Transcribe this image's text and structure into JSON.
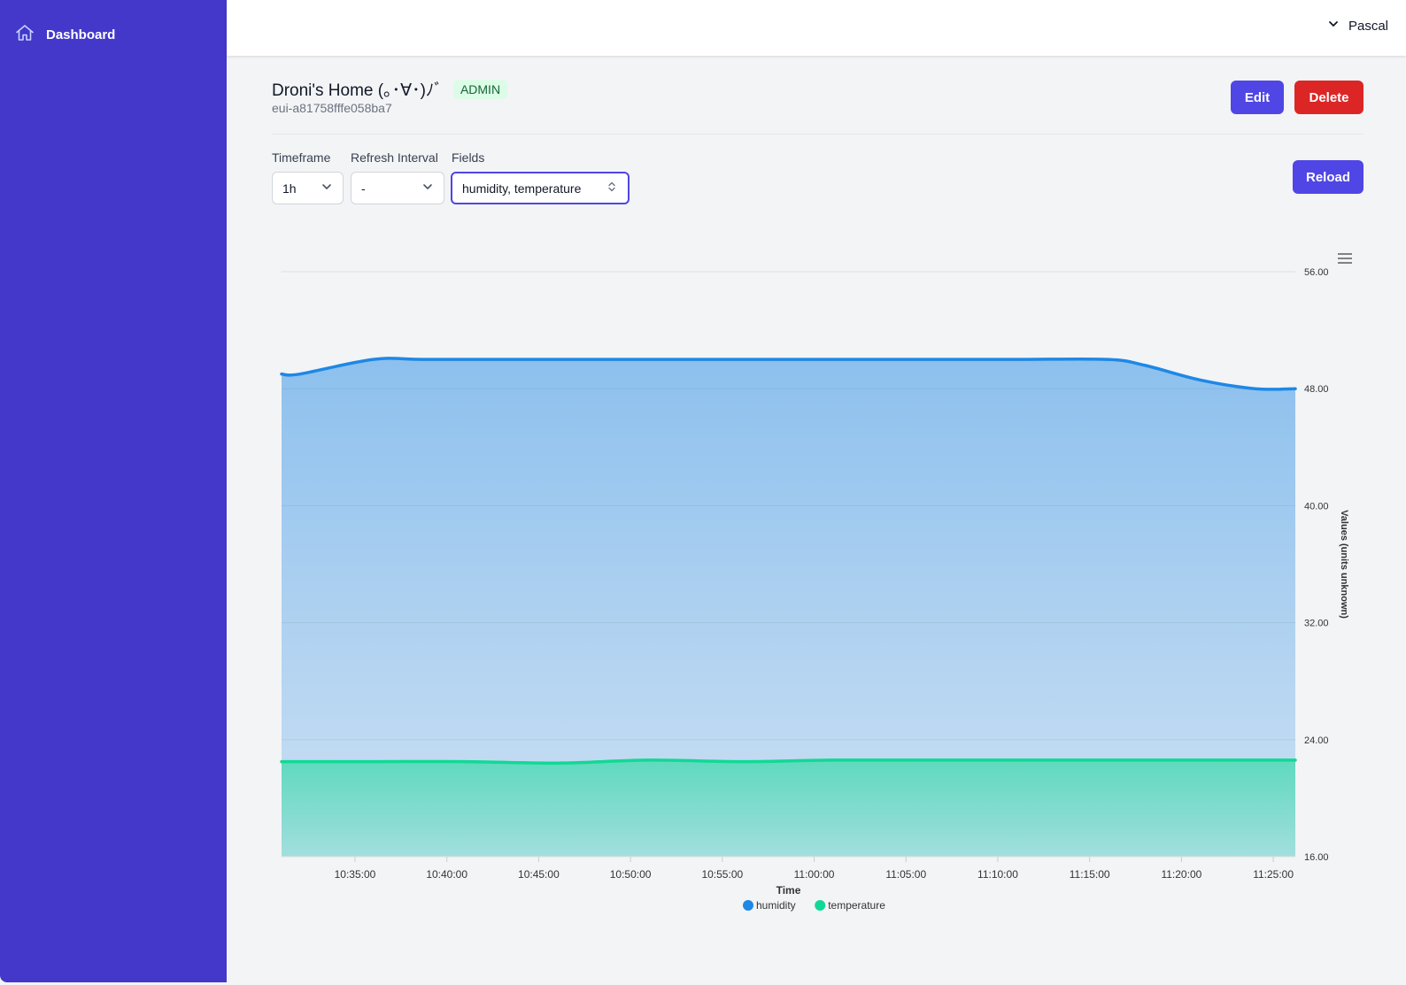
{
  "sidebar": {
    "items": [
      {
        "label": "Dashboard",
        "icon": "home-icon"
      }
    ]
  },
  "topbar": {
    "user_name": "Pascal"
  },
  "device": {
    "title": "Droni's Home (｡･∀･)ﾉﾞ",
    "role_badge": "ADMIN",
    "id": "eui-a81758fffe058ba7"
  },
  "actions": {
    "edit": "Edit",
    "delete": "Delete",
    "reload": "Reload"
  },
  "filters": {
    "timeframe_label": "Timeframe",
    "timeframe_value": "1h",
    "refresh_label": "Refresh Interval",
    "refresh_value": "-",
    "fields_label": "Fields",
    "fields_value": "humidity, temperature"
  },
  "colors": {
    "accent": "#4f46e5",
    "sidebar": "#4338ca",
    "danger": "#dc2626",
    "humidity": "#1e88e5",
    "temperature": "#10d995"
  },
  "chart_data": {
    "type": "area",
    "xlabel": "Time",
    "ylabel": "Values (units unknown)",
    "ylim": [
      16,
      56
    ],
    "y_ticks": [
      "16.00",
      "24.00",
      "32.00",
      "40.00",
      "48.00",
      "56.00"
    ],
    "x_ticks": [
      "10:35:00",
      "10:40:00",
      "10:45:00",
      "10:50:00",
      "10:55:00",
      "11:00:00",
      "11:05:00",
      "11:10:00",
      "11:15:00",
      "11:20:00",
      "11:25:00"
    ],
    "x_range_min": [
      -4,
      51.2
    ],
    "grid": true,
    "legend_position": "bottom-center",
    "series": [
      {
        "name": "humidity",
        "color": "#1e88e5",
        "x": [
          -4,
          -3,
          1,
          4,
          11,
          16,
          21,
          26,
          31,
          36,
          41,
          43,
          46,
          49,
          51.2
        ],
        "y": [
          49,
          49,
          50,
          50,
          50,
          50,
          50,
          50,
          50,
          50,
          50,
          49.6,
          48.6,
          48,
          48
        ]
      },
      {
        "name": "temperature",
        "color": "#10d995",
        "x": [
          -4,
          1,
          6,
          11,
          16,
          21,
          26,
          31,
          36,
          41,
          46,
          51.2
        ],
        "y": [
          22.5,
          22.5,
          22.5,
          22.4,
          22.6,
          22.5,
          22.6,
          22.6,
          22.6,
          22.6,
          22.6,
          22.6
        ]
      }
    ]
  }
}
